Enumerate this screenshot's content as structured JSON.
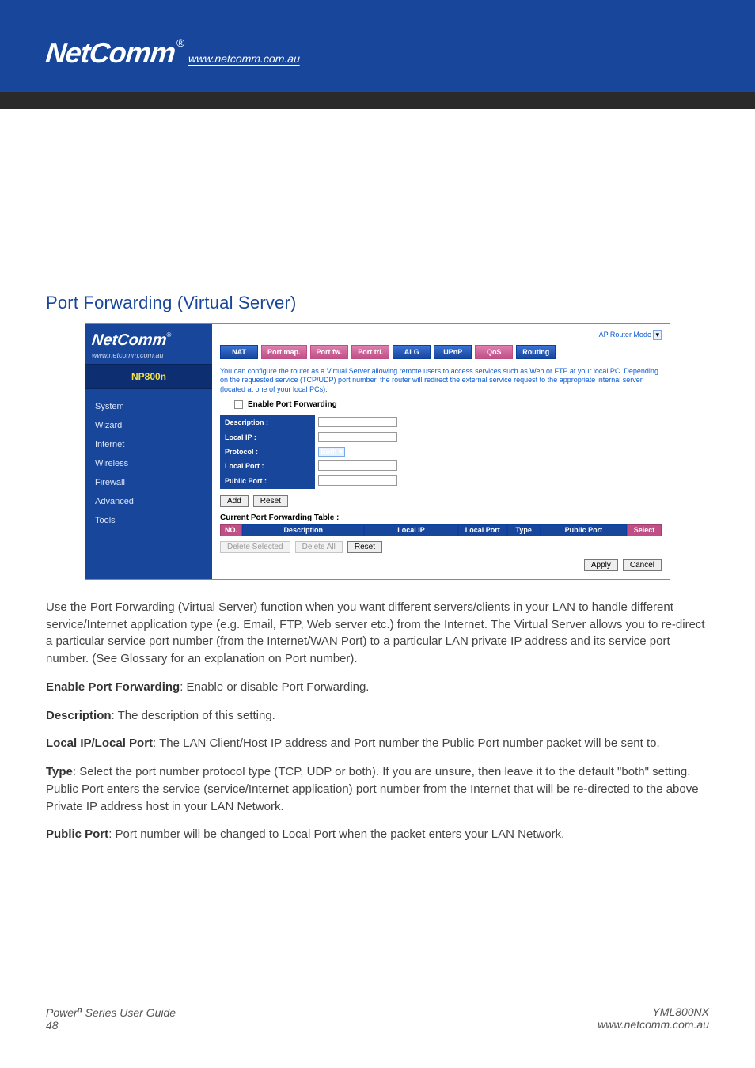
{
  "header": {
    "brand": "NetComm",
    "reg": "®",
    "url": "www.netcomm.com.au"
  },
  "section_title": "Port Forwarding (Virtual Server)",
  "screenshot": {
    "brand": "NetComm",
    "reg": "®",
    "brand_url": "www.netcomm.com.au",
    "model": "NP800n",
    "side_links": [
      "System",
      "Wizard",
      "Internet",
      "Wireless",
      "Firewall",
      "Advanced",
      "Tools"
    ],
    "mode_label": "AP Router Mode",
    "subtabs": [
      "NAT",
      "Port map.",
      "Port fw.",
      "Port tri.",
      "ALG",
      "UPnP",
      "QoS",
      "Routing"
    ],
    "intro": "You can configure the router as a Virtual Server allowing remote users to access services such as Web or FTP at your local PC. Depending on the requested service (TCP/UDP) port number, the router will redirect the external service request to the appropriate internal server (located at one of your local PCs).",
    "enable_label": "Enable Port Forwarding",
    "form": {
      "description_label": "Description :",
      "local_ip_label": "Local IP :",
      "protocol_label": "Protocol :",
      "protocol_value": "Both",
      "local_port_label": "Local Port :",
      "public_port_label": "Public Port :"
    },
    "buttons": {
      "add": "Add",
      "reset": "Reset",
      "delete_selected": "Delete Selected",
      "delete_all": "Delete All",
      "reset2": "Reset",
      "apply": "Apply",
      "cancel": "Cancel"
    },
    "table_title": "Current Port Forwarding Table :",
    "table_headers": {
      "no": "NO.",
      "description": "Description",
      "local_ip": "Local IP",
      "local_port": "Local Port",
      "type": "Type",
      "public_port": "Public Port",
      "select": "Select"
    }
  },
  "body": {
    "p1": "Use the Port Forwarding (Virtual Server) function when you want different servers/clients in your LAN to handle different service/Internet application type (e.g. Email, FTP, Web server etc.) from the Internet. The Virtual Server allows you to re-direct a particular service port number (from the Internet/WAN Port) to a particular LAN private IP address and its service port number. (See Glossary for an explanation on Port number).",
    "d1_label": "Enable Port Forwarding",
    "d1_text": ": Enable or disable Port Forwarding.",
    "d2_label": "Description",
    "d2_text": ": The description of this setting.",
    "d3_label": "Local IP/Local Port",
    "d3_text": ": The LAN Client/Host IP address and Port number the Public Port number packet will be sent to.",
    "d4_label": "Type",
    "d4_text": ": Select the port number protocol type (TCP, UDP or both). If you are unsure, then leave it to the default \"both\" setting. Public Port enters the service (service/Internet application) port number from the Internet that will be re-directed to the above Private IP address host in your LAN Network.",
    "d5_label": "Public Port",
    "d5_text": ": Port number will be changed to Local Port when the packet enters your LAN Network."
  },
  "footer": {
    "guide_prefix": "Power",
    "guide_sup": "n",
    "guide_suffix": " Series User Guide",
    "page_no": "48",
    "code": "YML800NX",
    "url": "www.netcomm.com.au"
  }
}
